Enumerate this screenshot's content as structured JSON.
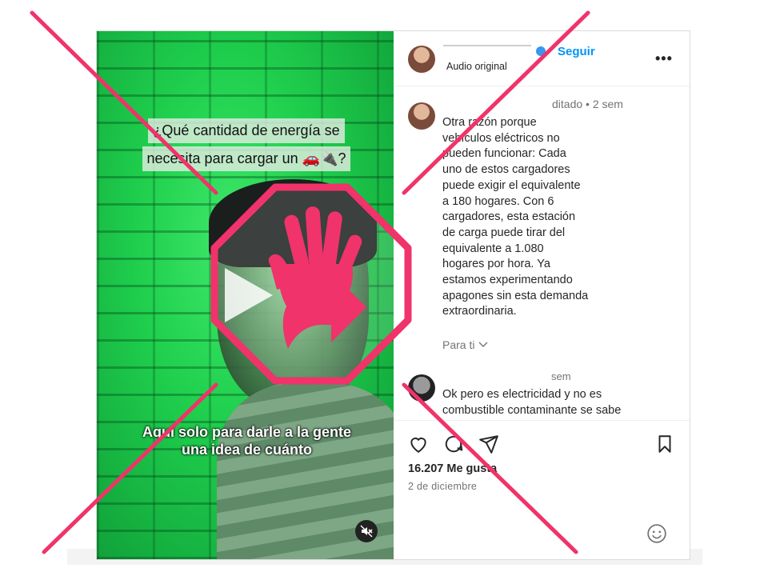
{
  "video": {
    "caption_top_lines": [
      "¿Qué cantidad de energía se",
      "necesita para cargar un 🚗🔌?"
    ],
    "caption_bottom_lines": [
      "Aquí solo para darle a la gente",
      "una idea de cuánto"
    ]
  },
  "header": {
    "follow_label": "Seguir",
    "audio_label": "Audio original",
    "more_label": "•••"
  },
  "comment1": {
    "meta": "ditado • 2 sem",
    "text_lines": [
      "Otra razón porque",
      "vehículos eléctricos no",
      "pueden funcionar: Cada",
      "uno de estos cargadores",
      "puede exigir el equivalente",
      "a 180 hogares. Con 6",
      "cargadores, esta estación",
      "de carga puede tirar del",
      "equivalente a 1.080",
      "hogares por hora. Ya",
      "estamos experimentando",
      "apagones sin esta demanda",
      "extraordinaria."
    ],
    "para_ti": "Para ti"
  },
  "comment2": {
    "meta": "sem",
    "text_lines": [
      "Ok pero es electricidad y no es",
      "combustible contaminante se sabe"
    ]
  },
  "footer": {
    "likes": "16.207 Me gusta",
    "date": "2 de diciembre"
  },
  "colors": {
    "accent": "#0095f6",
    "overlay_pink": "#f0336a",
    "video_green": "#1fcf4d"
  },
  "icons": [
    "play-icon",
    "mute-icon",
    "heart-icon",
    "comment-icon",
    "share-icon",
    "bookmark-icon",
    "emoji-icon",
    "stop-hand-icon"
  ]
}
